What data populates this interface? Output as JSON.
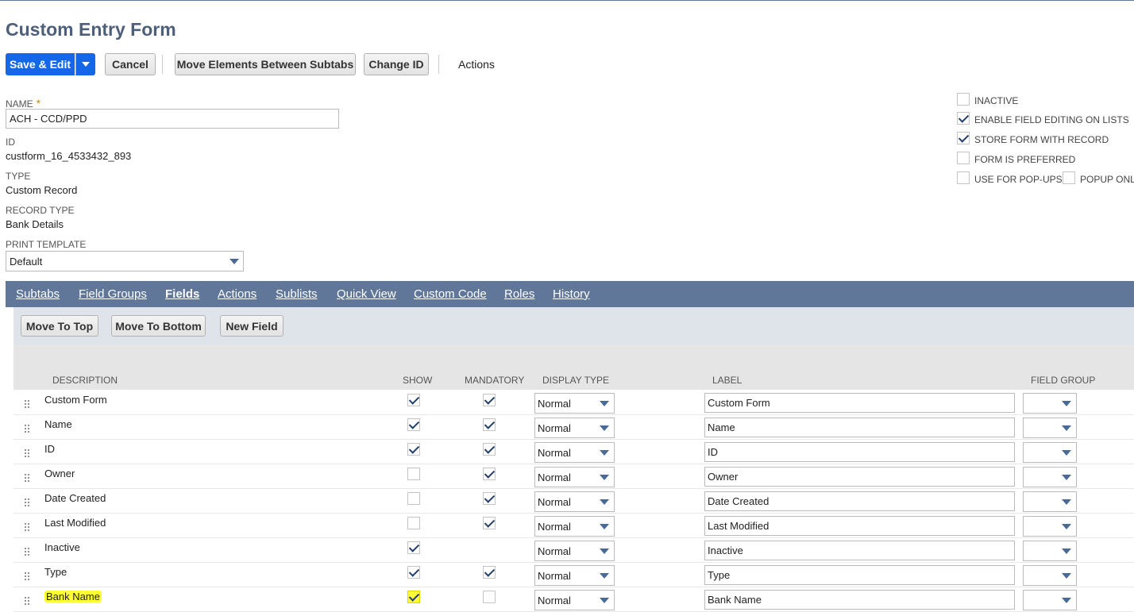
{
  "page": {
    "title": "Custom Entry Form"
  },
  "toolbar": {
    "save_edit": "Save & Edit",
    "cancel": "Cancel",
    "move_elements": "Move Elements Between Subtabs",
    "change_id": "Change ID",
    "actions": "Actions"
  },
  "fields": {
    "name_label": "NAME",
    "name_required": "*",
    "name_value": "ACH - CCD/PPD",
    "id_label": "ID",
    "id_value": "custform_16_4533432_893",
    "type_label": "TYPE",
    "type_value": "Custom Record",
    "record_type_label": "RECORD TYPE",
    "record_type_value": "Bank Details",
    "print_template_label": "PRINT TEMPLATE",
    "print_template_value": "Default"
  },
  "options": [
    {
      "label": "INACTIVE",
      "checked": false
    },
    {
      "label": "ENABLE FIELD EDITING ON LISTS",
      "checked": true
    },
    {
      "label": "STORE FORM WITH RECORD",
      "checked": true
    },
    {
      "label": "FORM IS PREFERRED",
      "checked": false
    },
    {
      "label": "USE FOR POP-UPS",
      "checked": false
    },
    {
      "label": "POPUP ONL",
      "checked": false
    }
  ],
  "tabs": [
    "Subtabs",
    "Field Groups",
    "Fields",
    "Actions",
    "Sublists",
    "Quick View",
    "Custom Code",
    "Roles",
    "History"
  ],
  "active_tab": "Fields",
  "subtoolbar": {
    "move_top": "Move To Top",
    "move_bottom": "Move To Bottom",
    "new_field": "New Field"
  },
  "columns": {
    "description": "DESCRIPTION",
    "show": "SHOW",
    "mandatory": "MANDATORY",
    "display_type": "DISPLAY TYPE",
    "label": "LABEL",
    "field_group": "FIELD GROUP"
  },
  "rows": [
    {
      "description": "Custom Form",
      "show": true,
      "mandatory": true,
      "display_type": "Normal",
      "label": "Custom Form"
    },
    {
      "description": "Name",
      "show": true,
      "mandatory": true,
      "display_type": "Normal",
      "label": "Name"
    },
    {
      "description": "ID",
      "show": true,
      "mandatory": true,
      "display_type": "Normal",
      "label": "ID"
    },
    {
      "description": "Owner",
      "show": false,
      "mandatory": true,
      "display_type": "Normal",
      "label": "Owner"
    },
    {
      "description": "Date Created",
      "show": false,
      "mandatory": true,
      "display_type": "Normal",
      "label": "Date Created"
    },
    {
      "description": "Last Modified",
      "show": false,
      "mandatory": true,
      "display_type": "Normal",
      "label": "Last Modified"
    },
    {
      "description": "Inactive",
      "show": true,
      "mandatory": null,
      "display_type": "Normal",
      "label": "Inactive"
    },
    {
      "description": "Type",
      "show": true,
      "mandatory": true,
      "display_type": "Normal",
      "label": "Type"
    },
    {
      "description": "Bank Name",
      "show": true,
      "mandatory": false,
      "display_type": "Normal",
      "label": "Bank Name",
      "highlighted": true
    }
  ],
  "colors": {
    "accent": "#1467e6",
    "tabbar": "#607799",
    "title": "#4d5f79",
    "highlight": "#ffff33"
  }
}
